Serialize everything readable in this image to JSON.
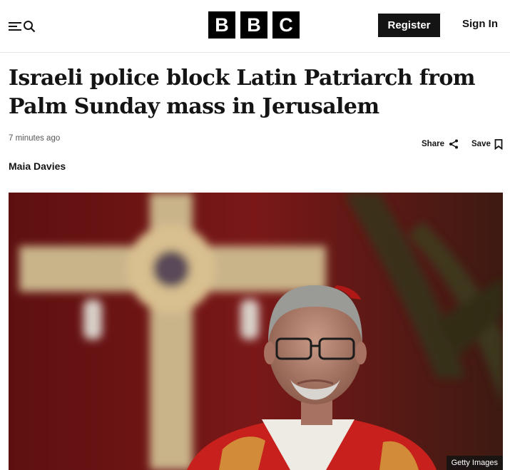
{
  "header": {
    "logo_letters": [
      "B",
      "B",
      "C"
    ],
    "register_label": "Register",
    "signin_label": "Sign In",
    "menu_icon": "menu-search-icon"
  },
  "article": {
    "headline": "Israeli police block Latin Patriarch from Palm Sunday mass in Jerusalem",
    "timestamp": "7 minutes ago",
    "share_label": "Share",
    "save_label": "Save",
    "byline": "Maia Davies"
  },
  "hero_image": {
    "credit": "Getty Images"
  },
  "colors": {
    "brand_black": "#000000",
    "text": "#141414",
    "muted": "#545658"
  }
}
